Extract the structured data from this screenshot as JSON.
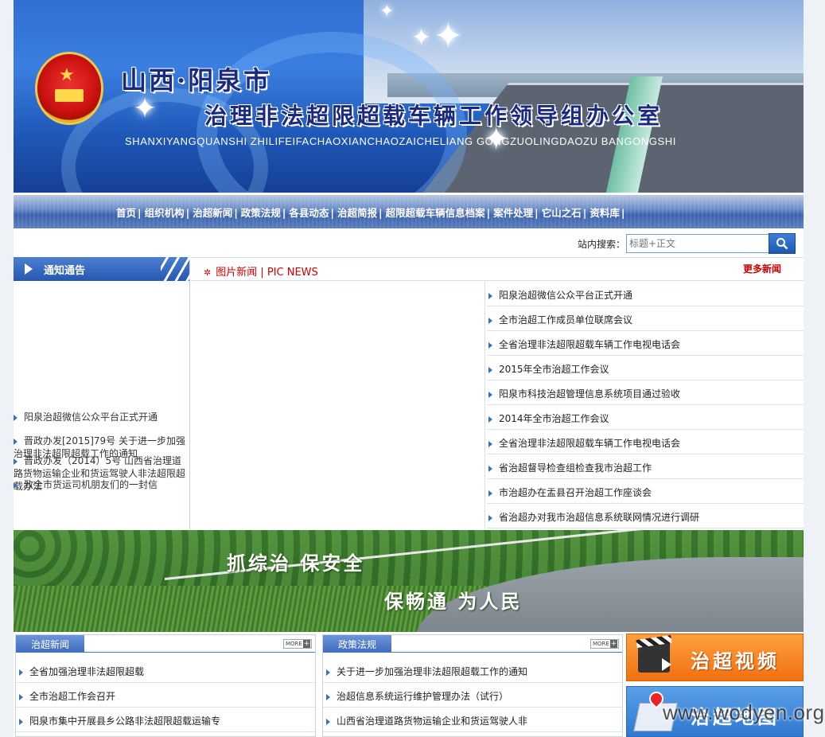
{
  "header": {
    "title_city": "山西·阳泉市",
    "title_office": "治理非法超限超载车辆工作领导组办公室",
    "title_pinyin": "SHANXIYANGQUANSHI  ZHILIFEIFACHAOXIANCHAOZAICHELIANG  GONGZUOLINGDAOZU  BANGONGSHI"
  },
  "nav": {
    "items": [
      {
        "label": "首页"
      },
      {
        "label": "组织机构"
      },
      {
        "label": "治超新闻"
      },
      {
        "label": "政策法规"
      },
      {
        "label": "各县动态"
      },
      {
        "label": "治超简报"
      },
      {
        "label": "超限超载车辆信息档案"
      },
      {
        "label": "案件处理"
      },
      {
        "label": "它山之石"
      },
      {
        "label": "资料库"
      }
    ],
    "separator": "|"
  },
  "search": {
    "label": "站内搜索：",
    "placeholder": "标题+正文"
  },
  "notice": {
    "title": "通知通告",
    "items": [
      {
        "label": "阳泉治超微信公众平台正式开通"
      },
      {
        "label": "晋政办发[2015]79号 关于进一步加强治理非法超限超载工作的通知"
      },
      {
        "label": "晋政办发（2014）5号 山西省治理道路货物运输企业和货运驾驶人非法超限超载办法"
      },
      {
        "label": "致全市货运司机朋友们的一封信"
      }
    ]
  },
  "picnews": {
    "title": "图片新闻  |  PIC NEWS",
    "more": "更多新闻",
    "items": [
      {
        "label": "阳泉治超微信公众平台正式开通"
      },
      {
        "label": "全市治超工作成员单位联席会议"
      },
      {
        "label": "全省治理非法超限超载车辆工作电视电话会"
      },
      {
        "label": "2015年全市治超工作会议"
      },
      {
        "label": "阳泉市科技治超管理信息系统项目通过验收"
      },
      {
        "label": "2014年全市治超工作会议"
      },
      {
        "label": "全省治理非法超限超载车辆工作电视电话会"
      },
      {
        "label": "省治超督导检查组检查我市治超工作"
      },
      {
        "label": "市治超办在盂县召开治超工作座谈会"
      },
      {
        "label": "省治超办对我市治超信息系统联网情况进行调研"
      }
    ]
  },
  "slogan": {
    "line1": "抓综治  保安全",
    "line2": "保畅通  为人民"
  },
  "news_box": {
    "tab": "治超新闻",
    "more": "MORE",
    "items": [
      {
        "label": "全省加强治理非法超限超载"
      },
      {
        "label": "全市治超工作会召开"
      },
      {
        "label": "阳泉市集中开展县乡公路非法超限超载运输专"
      }
    ]
  },
  "policy_box": {
    "tab": "政策法规",
    "more": "MORE",
    "items": [
      {
        "label": "关于进一步加强治理非法超限超载工作的通知"
      },
      {
        "label": "治超信息系统运行维护管理办法（试行）"
      },
      {
        "label": "山西省治理道路货物运输企业和货运驾驶人非"
      }
    ]
  },
  "side": {
    "video_label": "治超视频",
    "map_label": "治超地图"
  },
  "watermark": "www.wodyen.org",
  "colors": {
    "accent_blue": "#2658b2",
    "news_red": "#cc0000",
    "video_orange": "#f07010"
  }
}
